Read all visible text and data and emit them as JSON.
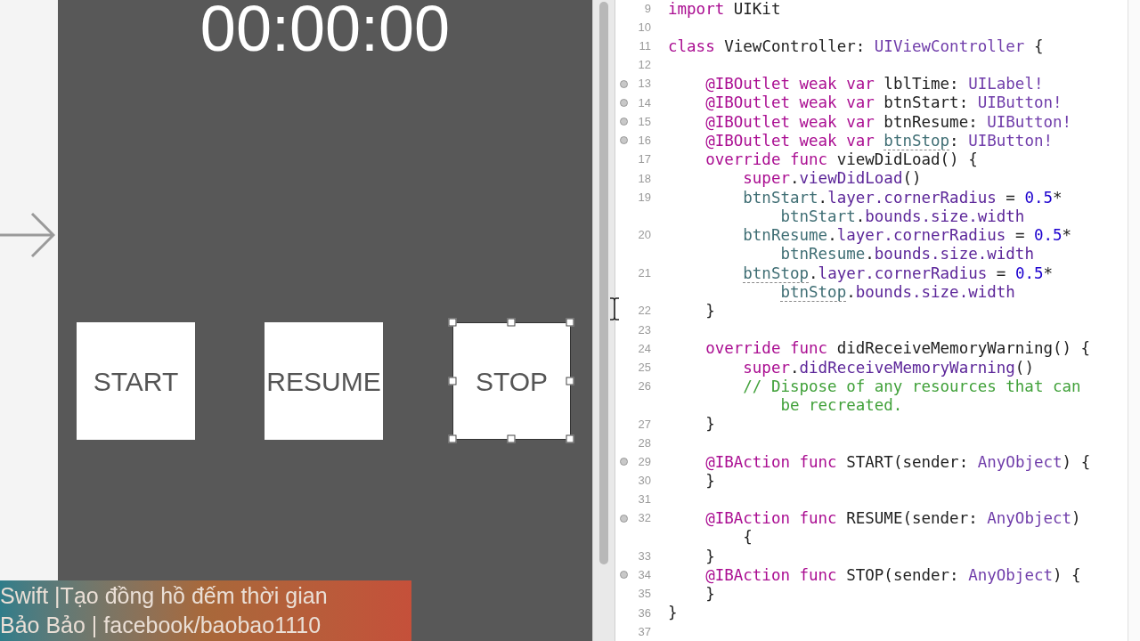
{
  "canvas": {
    "timer_label": "00:00:00",
    "buttons": [
      {
        "label": "START",
        "selected": false
      },
      {
        "label": "RESUME",
        "selected": false
      },
      {
        "label": "STOP",
        "selected": true
      }
    ]
  },
  "editor": {
    "lines": [
      {
        "number": "9",
        "breakpoint": false,
        "parts": [
          {
            "segments": [
              {
                "text": "import",
                "kind": "keyword"
              },
              {
                "text": " UIKit",
                "kind": "plain"
              }
            ]
          }
        ]
      },
      {
        "number": "10",
        "breakpoint": false
      },
      {
        "number": "11",
        "breakpoint": false,
        "parts": [
          {
            "segments": [
              {
                "text": "class",
                "kind": "keyword"
              },
              {
                "text": " ViewController: ",
                "kind": "plain"
              },
              {
                "text": "UIViewController",
                "kind": "type"
              },
              {
                "text": " {",
                "kind": "plain"
              }
            ]
          }
        ]
      },
      {
        "number": "12",
        "breakpoint": false
      },
      {
        "number": "13",
        "breakpoint": true,
        "parts": [
          {
            "segments": [
              {
                "text": "    @IBOutlet weak var",
                "kind": "keyword"
              },
              {
                "text": " lblTime: ",
                "kind": "plain"
              },
              {
                "text": "UILabel!",
                "kind": "type"
              }
            ]
          }
        ]
      },
      {
        "number": "14",
        "breakpoint": true,
        "parts": [
          {
            "segments": [
              {
                "text": "    @IBOutlet weak var",
                "kind": "keyword"
              },
              {
                "text": " btnStart: ",
                "kind": "plain"
              },
              {
                "text": "UIButton!",
                "kind": "type"
              }
            ]
          }
        ]
      },
      {
        "number": "15",
        "breakpoint": true,
        "parts": [
          {
            "segments": [
              {
                "text": "    @IBOutlet weak var",
                "kind": "keyword"
              },
              {
                "text": " btnResume: ",
                "kind": "plain"
              },
              {
                "text": "UIButton!",
                "kind": "type"
              }
            ]
          }
        ]
      },
      {
        "number": "16",
        "breakpoint": true,
        "parts": [
          {
            "segments": [
              {
                "text": "    @IBOutlet weak var ",
                "kind": "keyword"
              },
              {
                "text": "btnStop",
                "kind": "flagged"
              },
              {
                "text": ": ",
                "kind": "plain"
              },
              {
                "text": "UIButton!",
                "kind": "type"
              }
            ]
          }
        ]
      },
      {
        "number": "17",
        "breakpoint": false,
        "parts": [
          {
            "segments": [
              {
                "text": "    override func",
                "kind": "keyword"
              },
              {
                "text": " viewDidLoad() {",
                "kind": "plain"
              }
            ]
          }
        ]
      },
      {
        "number": "18",
        "breakpoint": false,
        "parts": [
          {
            "segments": [
              {
                "text": "        super",
                "kind": "keyword"
              },
              {
                "text": ".",
                "kind": "plain"
              },
              {
                "text": "viewDidLoad",
                "kind": "member"
              },
              {
                "text": "()",
                "kind": "plain"
              }
            ]
          }
        ]
      },
      {
        "number": "19",
        "breakpoint": false,
        "parts": [
          {
            "segments": [
              {
                "text": "        btnStart",
                "kind": "ident"
              },
              {
                "text": ".",
                "kind": "plain"
              },
              {
                "text": "layer.cornerRadius",
                "kind": "member"
              },
              {
                "text": " = ",
                "kind": "plain"
              },
              {
                "text": "0.5",
                "kind": "number"
              },
              {
                "text": "*",
                "kind": "plain"
              }
            ]
          },
          {
            "segments": [
              {
                "text": "            btnStart",
                "kind": "ident"
              },
              {
                "text": ".",
                "kind": "plain"
              },
              {
                "text": "bounds.size.width",
                "kind": "member"
              }
            ]
          }
        ]
      },
      {
        "number": "20",
        "breakpoint": false,
        "parts": [
          {
            "segments": [
              {
                "text": "        btnResume",
                "kind": "ident"
              },
              {
                "text": ".",
                "kind": "plain"
              },
              {
                "text": "layer.cornerRadius",
                "kind": "member"
              },
              {
                "text": " = ",
                "kind": "plain"
              },
              {
                "text": "0.5",
                "kind": "number"
              },
              {
                "text": "*",
                "kind": "plain"
              }
            ]
          },
          {
            "segments": [
              {
                "text": "            btnResume",
                "kind": "ident"
              },
              {
                "text": ".",
                "kind": "plain"
              },
              {
                "text": "bounds.size.width",
                "kind": "member"
              }
            ]
          }
        ]
      },
      {
        "number": "21",
        "breakpoint": false,
        "parts": [
          {
            "segments": [
              {
                "text": "        btnStop",
                "kind": "flagged"
              },
              {
                "text": ".",
                "kind": "plain"
              },
              {
                "text": "layer.cornerRadius",
                "kind": "member"
              },
              {
                "text": " = ",
                "kind": "plain"
              },
              {
                "text": "0.5",
                "kind": "number"
              },
              {
                "text": "*",
                "kind": "plain"
              }
            ]
          },
          {
            "segments": [
              {
                "text": "            btnStop",
                "kind": "flagged"
              },
              {
                "text": ".",
                "kind": "plain"
              },
              {
                "text": "bounds.size.width",
                "kind": "member"
              }
            ]
          }
        ]
      },
      {
        "number": "22",
        "breakpoint": false,
        "parts": [
          {
            "segments": [
              {
                "text": "    }",
                "kind": "plain"
              }
            ]
          }
        ]
      },
      {
        "number": "23",
        "breakpoint": false
      },
      {
        "number": "24",
        "breakpoint": false,
        "parts": [
          {
            "segments": [
              {
                "text": "    override func",
                "kind": "keyword"
              },
              {
                "text": " didReceiveMemoryWarning() {",
                "kind": "plain"
              }
            ]
          }
        ]
      },
      {
        "number": "25",
        "breakpoint": false,
        "parts": [
          {
            "segments": [
              {
                "text": "        super",
                "kind": "keyword"
              },
              {
                "text": ".",
                "kind": "plain"
              },
              {
                "text": "didReceiveMemoryWarning",
                "kind": "member"
              },
              {
                "text": "()",
                "kind": "plain"
              }
            ]
          }
        ]
      },
      {
        "number": "26",
        "breakpoint": false,
        "parts": [
          {
            "segments": [
              {
                "text": "        // Dispose of any resources that can",
                "kind": "comment"
              }
            ]
          },
          {
            "segments": [
              {
                "text": "            be recreated.",
                "kind": "comment"
              }
            ]
          }
        ]
      },
      {
        "number": "27",
        "breakpoint": false,
        "parts": [
          {
            "segments": [
              {
                "text": "    }",
                "kind": "plain"
              }
            ]
          }
        ]
      },
      {
        "number": "28",
        "breakpoint": false
      },
      {
        "number": "29",
        "breakpoint": true,
        "parts": [
          {
            "segments": [
              {
                "text": "    @IBAction func",
                "kind": "keyword"
              },
              {
                "text": " START(sender: ",
                "kind": "plain"
              },
              {
                "text": "AnyObject",
                "kind": "type"
              },
              {
                "text": ") {",
                "kind": "plain"
              }
            ]
          }
        ]
      },
      {
        "number": "30",
        "breakpoint": false,
        "parts": [
          {
            "segments": [
              {
                "text": "    }",
                "kind": "plain"
              }
            ]
          }
        ]
      },
      {
        "number": "31",
        "breakpoint": false
      },
      {
        "number": "32",
        "breakpoint": true,
        "parts": [
          {
            "segments": [
              {
                "text": "    @IBAction func",
                "kind": "keyword"
              },
              {
                "text": " RESUME(sender: ",
                "kind": "plain"
              },
              {
                "text": "AnyObject",
                "kind": "type"
              },
              {
                "text": ")",
                "kind": "plain"
              }
            ]
          },
          {
            "segments": [
              {
                "text": "        {",
                "kind": "plain"
              }
            ]
          }
        ]
      },
      {
        "number": "33",
        "breakpoint": false,
        "parts": [
          {
            "segments": [
              {
                "text": "    }",
                "kind": "plain"
              }
            ]
          }
        ]
      },
      {
        "number": "34",
        "breakpoint": true,
        "parts": [
          {
            "segments": [
              {
                "text": "    @IBAction func",
                "kind": "keyword"
              },
              {
                "text": " STOP(sender: ",
                "kind": "plain"
              },
              {
                "text": "AnyObject",
                "kind": "type"
              },
              {
                "text": ") {",
                "kind": "plain"
              }
            ]
          }
        ]
      },
      {
        "number": "35",
        "breakpoint": false,
        "parts": [
          {
            "segments": [
              {
                "text": "    }",
                "kind": "plain"
              }
            ]
          }
        ]
      },
      {
        "number": "36",
        "breakpoint": false,
        "parts": [
          {
            "segments": [
              {
                "text": "}",
                "kind": "plain"
              }
            ]
          }
        ]
      },
      {
        "number": "37",
        "breakpoint": false
      }
    ]
  },
  "caption": {
    "lines": [
      "Swift |Tạo đồng hồ đếm thời gian",
      "Bảo Bảo | facebook/baobao1110"
    ]
  }
}
